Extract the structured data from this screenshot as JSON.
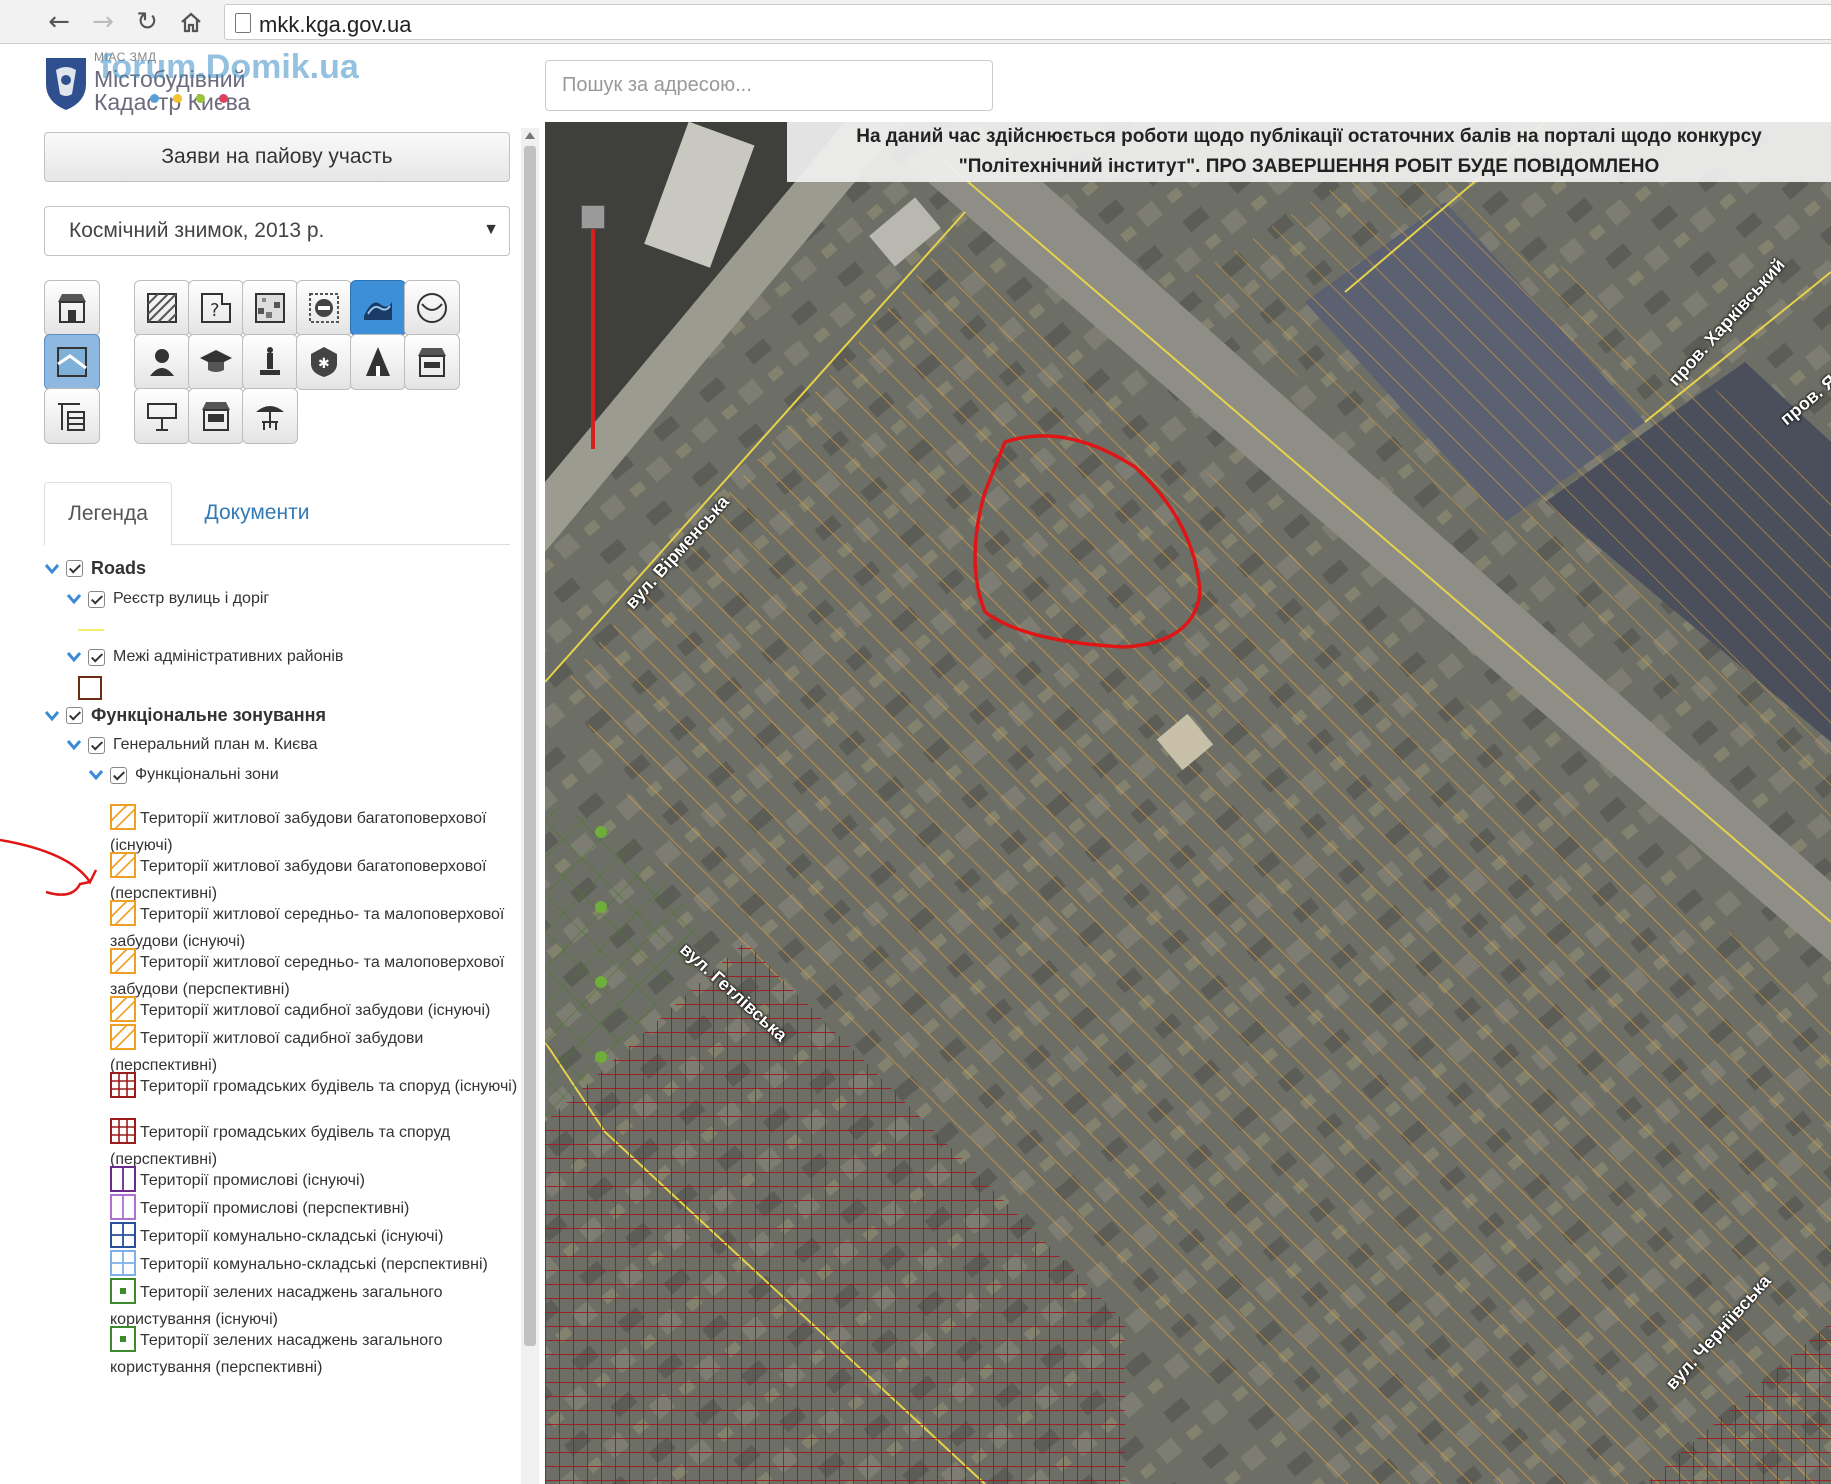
{
  "browser": {
    "url": "mkk.kga.gov.ua"
  },
  "header": {
    "logo_small": "МІАС ЗМД",
    "logo_line1": "Містобудівний",
    "logo_line2": "Кадастр Києва",
    "watermark": "forum.Domik.ua",
    "search_placeholder": "Пошук за адресою..."
  },
  "sidebar": {
    "apply_button": "Заяви на пайову участь",
    "basemap_select": "Космічний знимок, 2013 р.",
    "tabs": [
      "Легенда",
      "Документи"
    ]
  },
  "legend": {
    "roads": "Roads",
    "streets_registry": "Реєстр вулиць і доріг",
    "admin_districts": "Межі адміністративних районів",
    "functional_zoning": "Функціональне зонування",
    "master_plan": "Генеральний план м. Києва",
    "functional_zones": "Функціональні зони",
    "items": [
      {
        "label": "Території житлової забудови багатоповерхової (існуючі)",
        "color": "#f0a020"
      },
      {
        "label": "Території житлової забудови багатоповерхової (перспективні)",
        "color": "#f0a020"
      },
      {
        "label": "Території житлової середньо- та малоповерхової забудови (існуючі)",
        "color": "#f0a020"
      },
      {
        "label": "Території житлової середньо- та малоповерхової забудови (перспективні)",
        "color": "#f0a020"
      },
      {
        "label": "Території житлової садибної забудови (існуючі)",
        "color": "#f0a020"
      },
      {
        "label": "Території житлової садибної забудови (перспективні)",
        "color": "#f0a020"
      },
      {
        "label": "Території громадських будівель та споруд (існуючі)",
        "color": "#9b1c1c"
      },
      {
        "label": "Території громадських будівель та споруд (перспективні)",
        "color": "#9b1c1c"
      },
      {
        "label": "Території промислові (існуючі)",
        "color": "#6a2c8a"
      },
      {
        "label": "Території промислові (перспективні)",
        "color": "#b070d0"
      },
      {
        "label": "Території комунально-складські (існуючі)",
        "color": "#2b4f9c"
      },
      {
        "label": "Території комунально-складські (перспективні)",
        "color": "#7fb0e8"
      },
      {
        "label": "Території зелених насаджень загального користування (існуючі)",
        "color": "#3d8a2a"
      },
      {
        "label": "Території зелених насаджень загального користування (перспективні)",
        "color": "#3d8a2a"
      }
    ]
  },
  "map": {
    "notice_line1": "На даний час здійснюється роботи щодо публікації остаточних балів на порталі щодо конкурсу",
    "notice_line2": "\"Політехнічний інститут\". ПРО ЗАВЕРШЕННЯ РОБІТ БУДЕ ПОВІДОМЛЕНО",
    "streets": [
      "пров. Харківський",
      "пров. Ялинковий",
      "вул. Вірменська",
      "вул. Гетлівська",
      "вул. Черніївська"
    ]
  },
  "colors": {
    "accent": "#3d8fd8",
    "link": "#337ab7",
    "zone_orange": "#f0a020",
    "zone_red": "#9b1c1c",
    "annotation_red": "#e01515"
  }
}
